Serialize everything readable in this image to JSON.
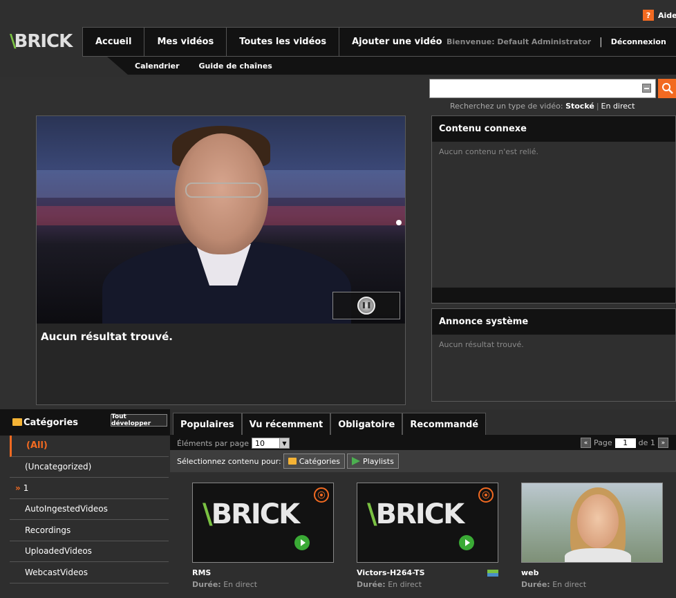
{
  "header": {
    "help_label": "Aide",
    "help_icon": "help-icon",
    "logo_text": "BRICK",
    "nav": [
      "Accueil",
      "Mes vidéos",
      "Toutes les vidéos",
      "Ajouter une vidéo"
    ],
    "welcome": "Bienvenue: Default Administrator",
    "logout": "Déconnexion",
    "subnav": [
      "Calendrier",
      "Guide de chaînes"
    ]
  },
  "search": {
    "value": "",
    "prompt": "Recherchez un type de vidéo:",
    "type_stored": "Stocké",
    "type_live": "En direct"
  },
  "player": {
    "no_result": "Aucun résultat trouvé."
  },
  "related": {
    "title": "Contenu connexe",
    "body": "Aucun contenu n'est relié."
  },
  "announce": {
    "title": "Annonce système",
    "body": "Aucun résultat trouvé."
  },
  "categories": {
    "title": "Catégories",
    "expand_all": "Tout développer",
    "items": [
      "(All)",
      "(Uncategorized)",
      "1",
      "AutoIngestedVideos",
      "Recordings",
      "UploadedVideos",
      "WebcastVideos"
    ]
  },
  "tabs": [
    "Populaires",
    "Vu récemment",
    "Obligatoire",
    "Recommandé"
  ],
  "listing": {
    "per_page_label": "Éléments par page",
    "per_page_value": "10",
    "page_label": "Page",
    "page_value": "1",
    "page_of": "de 1",
    "select_for": "Sélectionnez contenu pour:",
    "btn_categories": "Catégories",
    "btn_playlists": "Playlists"
  },
  "videos": [
    {
      "title": "RMS",
      "duration_label": "Durée:",
      "duration": "En direct"
    },
    {
      "title": "Victors-H264-TS",
      "duration_label": "Durée:",
      "duration": "En direct"
    },
    {
      "title": "web",
      "duration_label": "Durée:",
      "duration": "En direct"
    }
  ],
  "colors": {
    "accent": "#f26a21",
    "brand_green": "#7ac142",
    "bar": "#121212"
  }
}
